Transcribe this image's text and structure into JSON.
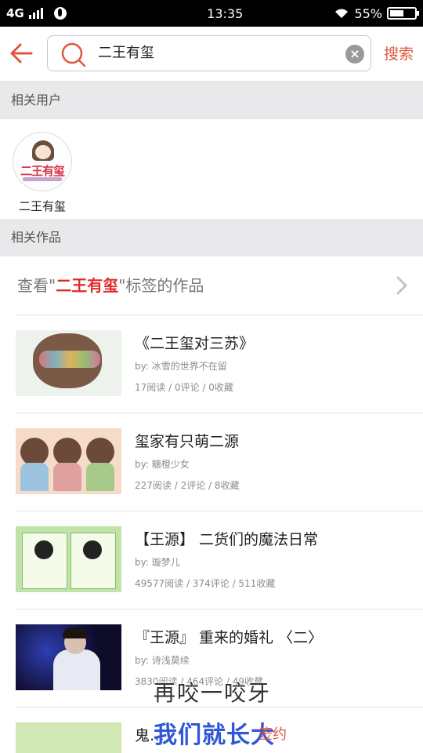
{
  "status_bar": {
    "network": "4G",
    "time": "13:35",
    "battery": "55%",
    "battery_level": 0.55
  },
  "search": {
    "query": "二王有玺",
    "search_label": "搜索"
  },
  "related_users": {
    "header": "相关用户",
    "users": [
      {
        "name": "二王有玺",
        "avatar_text": "二王有玺"
      }
    ]
  },
  "related_works": {
    "header": "相关作品",
    "tag_link": {
      "prefix": "查看\"",
      "tag": "二王有玺",
      "suffix": "\"标签的作品"
    },
    "items": [
      {
        "title": "《二王玺对三苏》",
        "author": "by: 冰雪的世界不在留",
        "stats": "17阅读 / 0评论 / 0收藏"
      },
      {
        "title": "玺家有只萌二源",
        "author": "by: 糖橙少女",
        "stats": "227阅读 / 2评论 / 8收藏"
      },
      {
        "title": "【王源】 二货们的魔法日常",
        "author": "by: 璇梦儿",
        "stats": "49577阅读 / 374评论 / 511收藏"
      },
      {
        "title": "『王源』 重来的婚礼 〈二〉",
        "author": "by: 诗浅莫续",
        "stats": "3830阅读 / 464评论 / 49收藏"
      },
      {
        "title": "鬼…",
        "author": "",
        "stats": ""
      }
    ]
  },
  "overlay": {
    "line1": "再咬一咬牙",
    "line2": "我们就长大",
    "line3": "签约"
  },
  "colors": {
    "accent": "#e0553f",
    "highlight": "#e02b2b",
    "section_bg": "#e9e9eb"
  }
}
